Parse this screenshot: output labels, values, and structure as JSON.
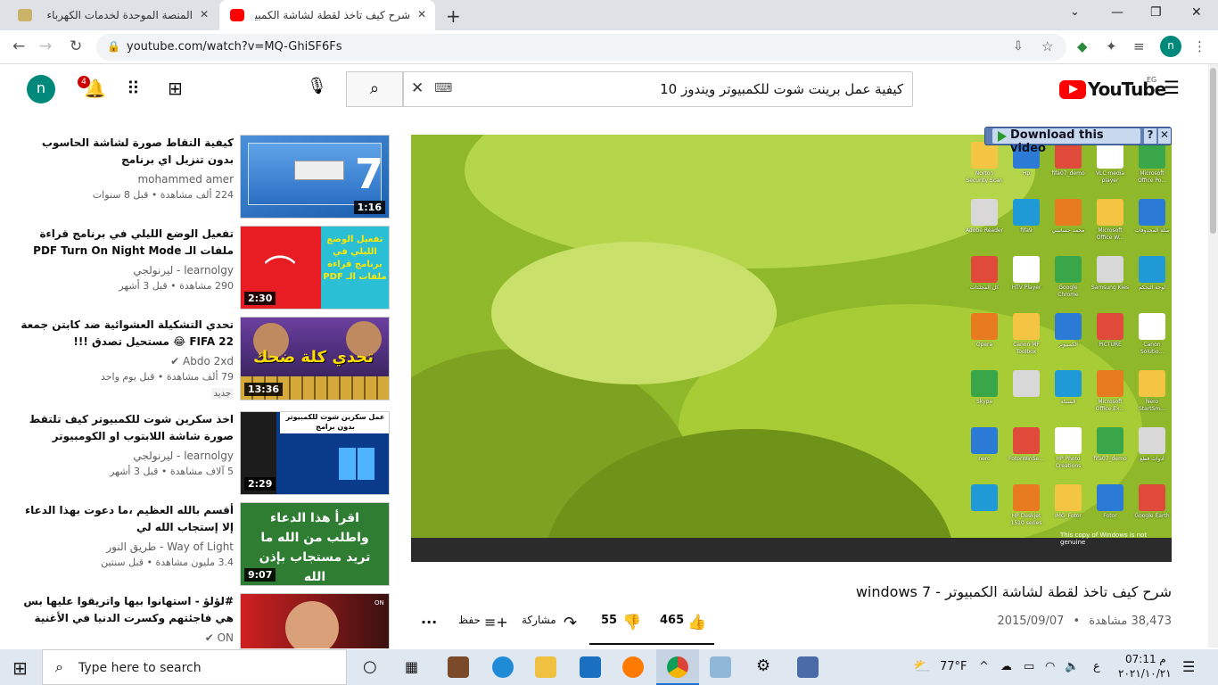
{
  "browser": {
    "tabs": [
      {
        "label": "المنصة الموحدة لخدمات الكهرباء 's"
      },
      {
        "label": "شرح كيف تاخذ لقطة لشاشة الكمبيوتر"
      }
    ],
    "url": "youtube.com/watch?v=MQ-GhiSF6Fs",
    "profile_initial": "n"
  },
  "youtube": {
    "region": "EG",
    "search_query": "كيفية عمل برينت شوت للكمبيوتر ويندوز 10",
    "notifications": "4",
    "avatar": "n",
    "logo": "YouTube"
  },
  "recommendations": [
    {
      "title": "كيفية التقاط صورة لشاشة الحاسوب بدون تنزيل اي برنامج",
      "channel": "mohammed amer",
      "meta": "224 ألف مشاهدة • قبل 8 سنوات",
      "duration": "1:16",
      "new": ""
    },
    {
      "title": "تفعيل الوضع الليلي في برنامج قراءة ملفات الـ PDF Turn On Night Mode In...",
      "channel": "ليرنولجي - learnolgy",
      "meta": "290 مشاهدة • قبل 3 أشهر",
      "duration": "2:30",
      "new": ""
    },
    {
      "title": "تحدي التشكيلة العشوائية ضد كابتن جمعة FIFA 22 😂 مستحيل تصدق !!!",
      "channel": "Abdo 2xd",
      "meta": "79 ألف مشاهدة • قبل يوم واحد",
      "duration": "13:36",
      "new": "جديد"
    },
    {
      "title": "اخذ سكرين شوت للكمبيوتر كيف تلتقط صورة شاشة اللابتوب او الكومبيوتر بكل...",
      "channel": "ليرنولجي - learnolgy",
      "meta": "5 آلاف مشاهدة • قبل 3 أشهر",
      "duration": "2:29",
      "new": ""
    },
    {
      "title": "أقسم بالله العظيم ،ما دعوت بهذا الدعاء إلا إستجاب الله لي",
      "channel": "طريق النور - Way of Light",
      "meta": "3.4 مليون مشاهدة • قبل سنتين",
      "duration": "9:07",
      "new": ""
    },
    {
      "title": "#لؤلؤ - استهانوا بيها واتريقوا عليها بس هي فاجئتهم وكسرت الدنيا في الأغنية ...",
      "channel": "ON",
      "meta": "",
      "duration": "",
      "new": ""
    }
  ],
  "thumb_texts": {
    "pdf": "تفعيل الوضع الليلي في برنامج قراءة ملفات الـ PDF",
    "fifa": "تحدي كلة ضحك",
    "win": "عمل سكرين شوت للكمبيوتر بدون برامج",
    "dua": "اقرأ هذا الدعاء واطلب من الله ما تريد مستجاب بإذن الله"
  },
  "video": {
    "title": "شرح كيف تاخذ لقطة لشاشة الكمبيوتر - windows 7",
    "views": "38,473 مشاهدة",
    "date": "2015/09/07",
    "likes": "465",
    "dislikes": "55",
    "share": "مشاركة",
    "save": "حفظ",
    "download_label": "Download this video"
  },
  "desktop_icons": [
    "Norton Security Scan",
    "Hp",
    "fifa07_demo",
    "VLC media player",
    "Microsoft Office Po...",
    "Adobe Reader",
    "fifa9",
    "محمد حسانيني",
    "Microsoft Office W...",
    "سلة المحذوفات",
    "كل المجلدات",
    "HTV Player",
    "Google Chrome",
    "Samsung Kies",
    "لوحة التحكم",
    "Opera",
    "Canon MF Toolbox",
    "الكمبيوتر",
    "PICTURE",
    "Canon Solutio...",
    "Skype",
    "",
    "الشبكة",
    "Microsoft Office Ex...",
    "Nero StartSm...",
    "nero",
    "FotorWinSe...",
    "HP Photo Creations",
    "fifa07_demo",
    "أدوات قطع",
    "",
    "HP Deskjet 1510 series",
    "IMG_Fotor",
    "Fotor",
    "Google Earth"
  ],
  "windows_notice": "This copy of Windows is not genuine",
  "taskbar": {
    "search_placeholder": "Type here to search",
    "weather": "77°F",
    "time": "07:11 م",
    "date": "٢٠٢١/١٠/٢١",
    "lang": "ع"
  }
}
